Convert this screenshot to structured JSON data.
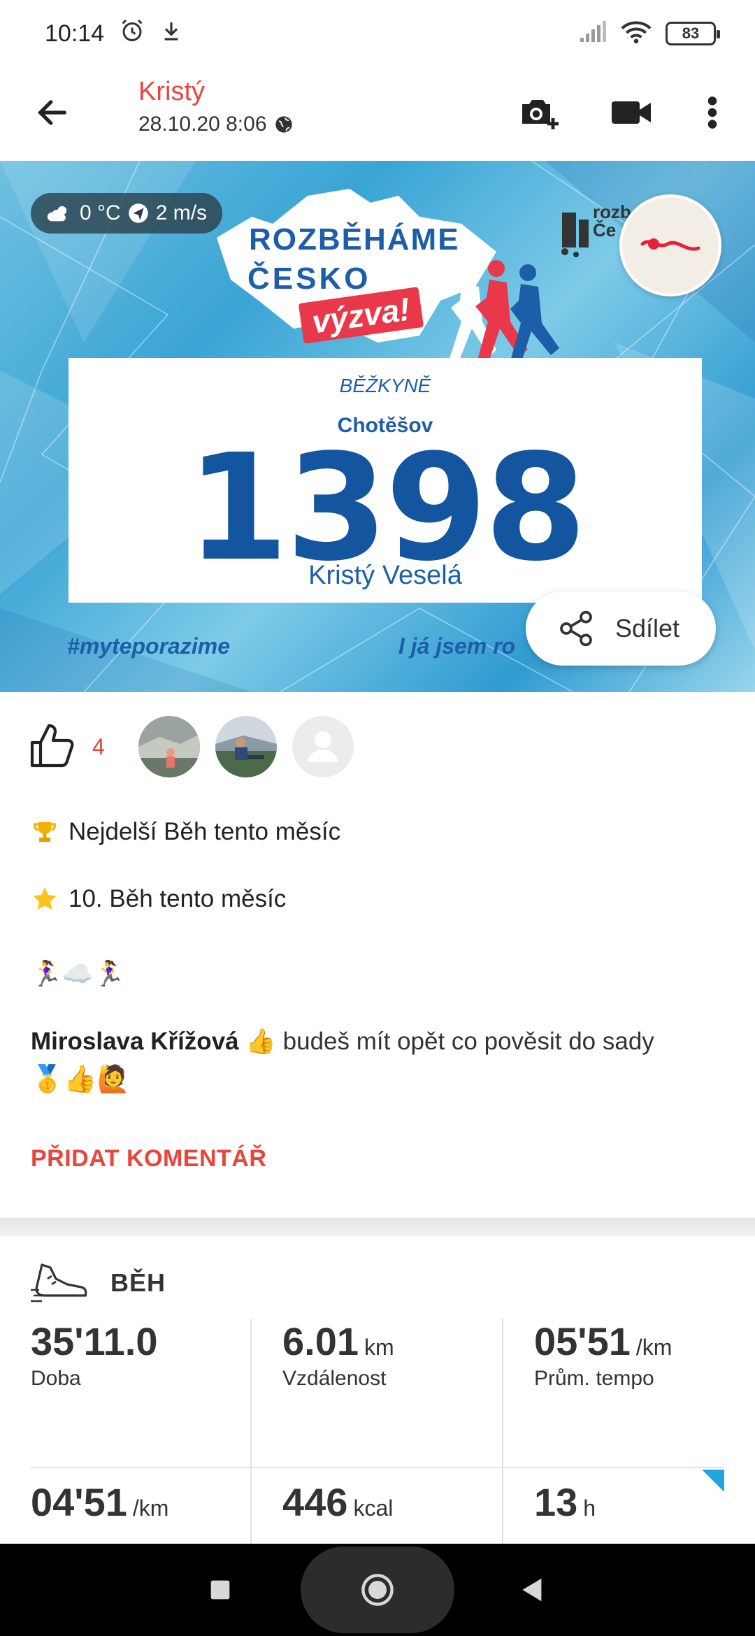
{
  "status_bar": {
    "time": "10:14",
    "battery": "83",
    "icons": [
      "alarm-icon",
      "download-icon",
      "signal-icon",
      "wifi-icon",
      "battery-icon"
    ]
  },
  "header": {
    "author": "Kristý",
    "date": "28.10.20 8:06",
    "icons": [
      "back-arrow-icon",
      "add-photo-icon",
      "video-icon",
      "more-vert-icon",
      "globe-icon"
    ]
  },
  "banner": {
    "weather": {
      "temp": "0 °C",
      "wind": "2 m/s"
    },
    "brand_line1": "ROZBĚHÁME",
    "brand_line2": "ČESKO",
    "brand_vyzva": "výzva!",
    "sponsor_text": "rozb\nČe",
    "bib": {
      "label": "BĚŽKYNĚ",
      "city": "Chotěšov",
      "number": "1398",
      "name": "Kristý Veselá"
    },
    "hashtag_left": "#myteporazime",
    "hashtag_right": "I já jsem ro",
    "share_label": "Sdílet",
    "colors": {
      "brand_blue": "#1455a0",
      "brand_red": "#e8384a"
    }
  },
  "likes": {
    "count": "4"
  },
  "achievements": [
    {
      "icon": "trophy-icon",
      "text": "Nejdelší Běh tento měsíc"
    },
    {
      "icon": "star-icon",
      "text": "10. Běh tento měsíc"
    }
  ],
  "post_emojis": "🏃‍♀️☁️🏃‍♀️",
  "comment": {
    "author": "Miroslava Křížová",
    "text": " 👍 budeš mít opět co pověsit do sady",
    "emojis": "🥇👍🙋"
  },
  "add_comment_label": "PŘIDAT KOMENTÁŘ",
  "activity": {
    "type": "BĚH",
    "stats": [
      {
        "value": "35'11.0",
        "unit": "",
        "label": "Doba"
      },
      {
        "value": "6.01",
        "unit": "km",
        "label": "Vzdálenost"
      },
      {
        "value": "05'51",
        "unit": "/km",
        "label": "Prům. tempo"
      },
      {
        "value": "04'51",
        "unit": "/km",
        "label": ""
      },
      {
        "value": "446",
        "unit": "kcal",
        "label": ""
      },
      {
        "value": "13",
        "unit": "h",
        "label": ""
      }
    ]
  },
  "colors": {
    "accent": "#e8453c"
  }
}
